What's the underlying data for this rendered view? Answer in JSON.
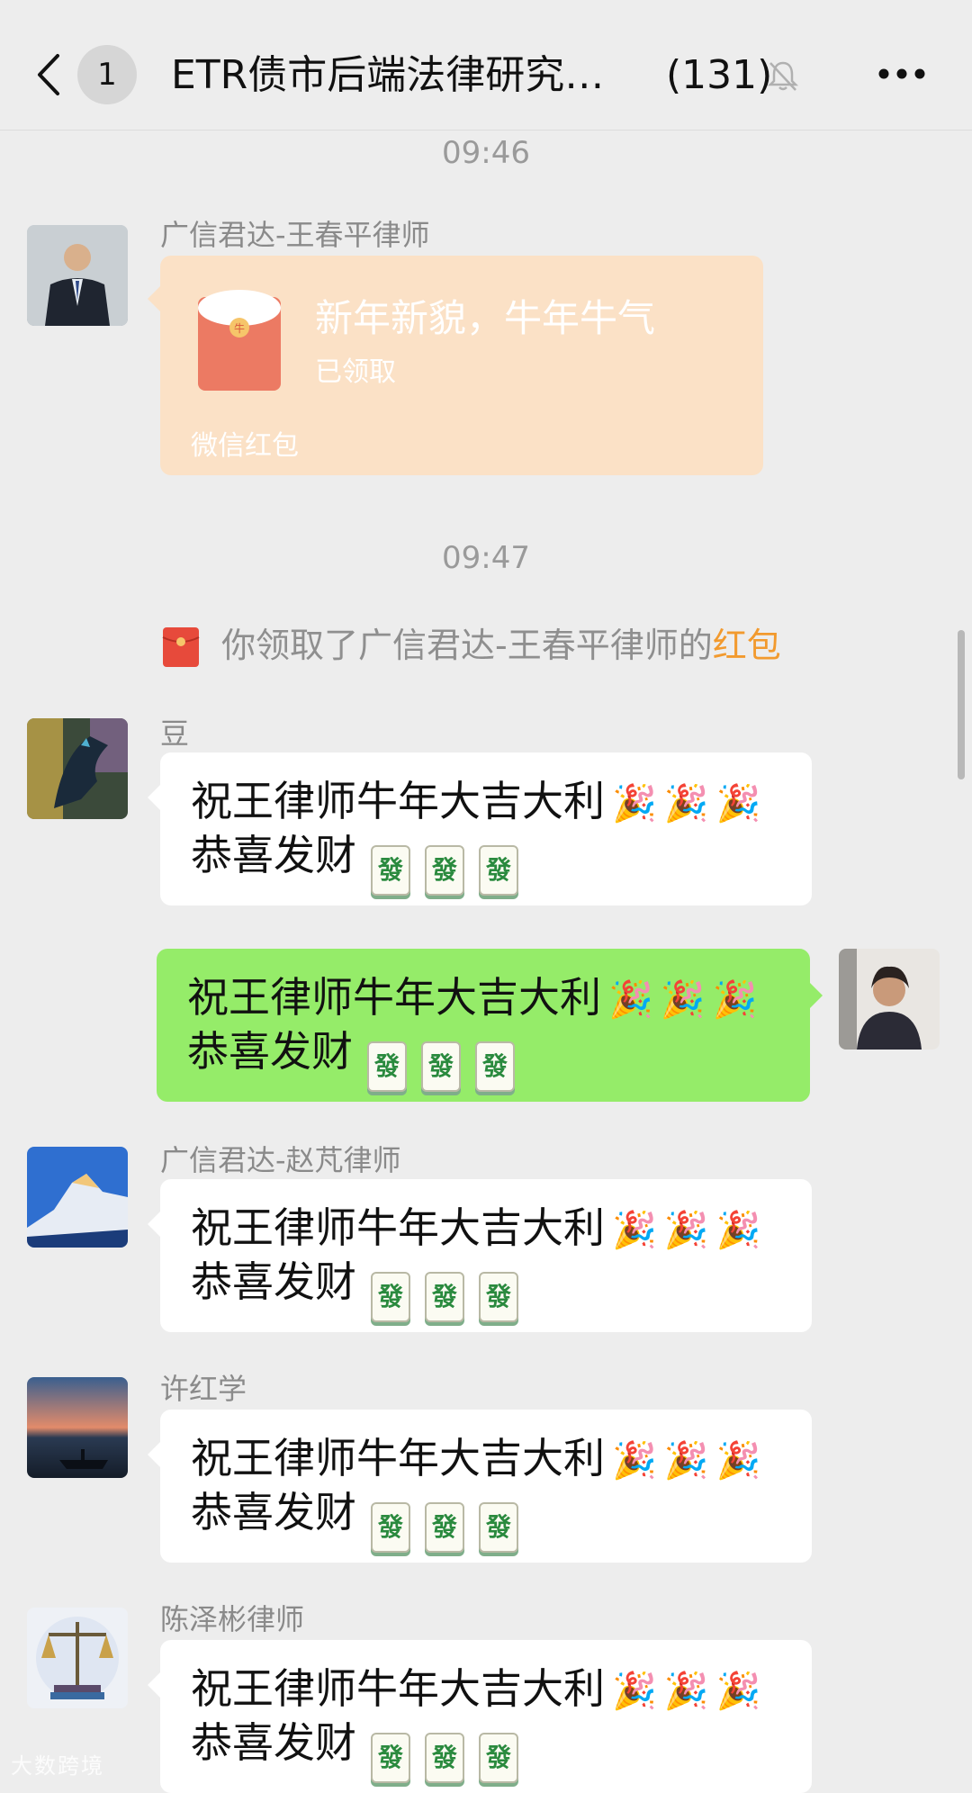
{
  "header": {
    "unread": "1",
    "title": "ETR债市后端法律研究…",
    "member_count": "(131)"
  },
  "times": [
    "09:46",
    "09:47"
  ],
  "red_packet": {
    "sender": "广信君达-王春平律师",
    "greeting": "新年新貌，牛年牛气",
    "status": "已领取",
    "footer": "微信红包",
    "color": "#fbe1c6"
  },
  "system_notice": {
    "prefix": "你领取了广信君达-王春平律师的",
    "highlight": "红包",
    "highlight_color": "#f29a2e"
  },
  "messages": [
    {
      "sender": "豆",
      "line1": "祝王律师牛年大吉大利",
      "line2": "恭喜发财",
      "mine": false
    },
    {
      "sender": "",
      "line1": "祝王律师牛年大吉大利",
      "line2": "恭喜发财",
      "mine": true
    },
    {
      "sender": "广信君达-赵芃律师",
      "line1": "祝王律师牛年大吉大利",
      "line2": "恭喜发财",
      "mine": false
    },
    {
      "sender": "许红学",
      "line1": "祝王律师牛年大吉大利",
      "line2": "恭喜发财",
      "mine": false
    },
    {
      "sender": "陈泽彬律师",
      "line1": "祝王律师牛年大吉大利",
      "line2": "恭喜发财",
      "mine": false
    }
  ],
  "emoji": {
    "party": "🎉",
    "mahjong": "發"
  },
  "watermark": "大数跨境",
  "colors": {
    "my_bubble": "#95ec69",
    "other_bubble": "#ffffff",
    "background": "#ededed"
  }
}
